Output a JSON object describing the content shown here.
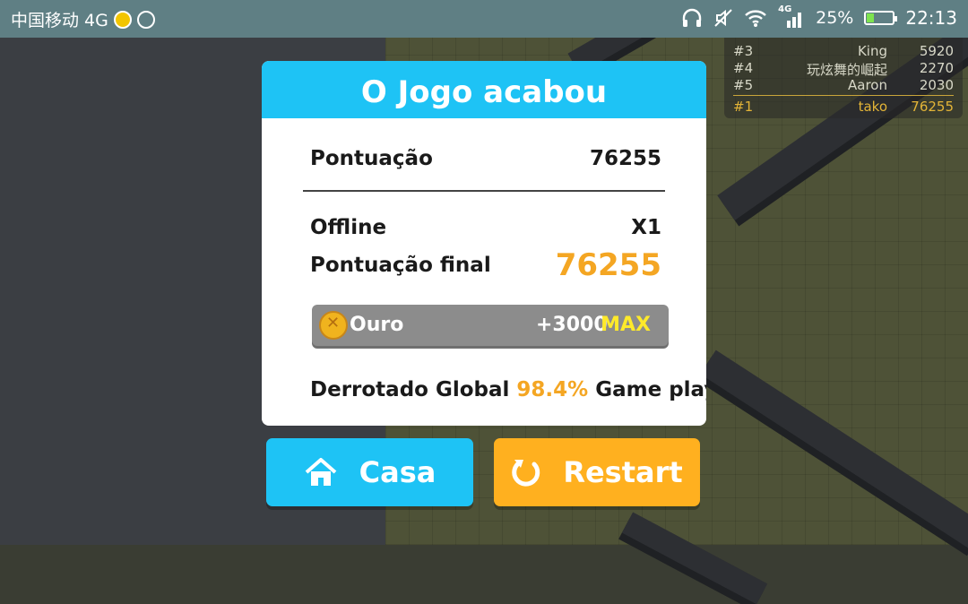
{
  "status_bar": {
    "carrier": "中国移动 4G",
    "network_badge": "4G",
    "battery": "25%",
    "time": "22:13",
    "battery_level": 0.25
  },
  "leaderboard": {
    "rows": [
      {
        "rank": "#3",
        "name": "King",
        "score": "5920"
      },
      {
        "rank": "#4",
        "name": "玩炫舞的崛起",
        "score": "2270"
      },
      {
        "rank": "#5",
        "name": "Aaron",
        "score": "2030"
      }
    ],
    "self": {
      "rank": "#1",
      "name": "tako",
      "score": "76255"
    }
  },
  "dialog": {
    "title": "O Jogo acabou",
    "score_label": "Pontuação",
    "score_value": "76255",
    "mode_label": "Offline",
    "mode_value": "X1",
    "final_label": "Pontuação final",
    "final_value": "76255",
    "reward": {
      "label": "Ouro",
      "amount": "+3000",
      "max": "MAX"
    },
    "global": {
      "prefix": "Derrotado Global",
      "percent": "98.4%",
      "suffix": "Game players"
    }
  },
  "buttons": {
    "home": "Casa",
    "restart": "Restart"
  },
  "colors": {
    "accent_blue": "#1ec3f5",
    "accent_orange": "#ffb01f",
    "highlight": "#f4a623"
  },
  "icons": [
    "headphones-icon",
    "mute-icon",
    "wifi-icon",
    "signal-icon",
    "battery-icon",
    "coin-icon",
    "home-icon",
    "restart-icon"
  ]
}
